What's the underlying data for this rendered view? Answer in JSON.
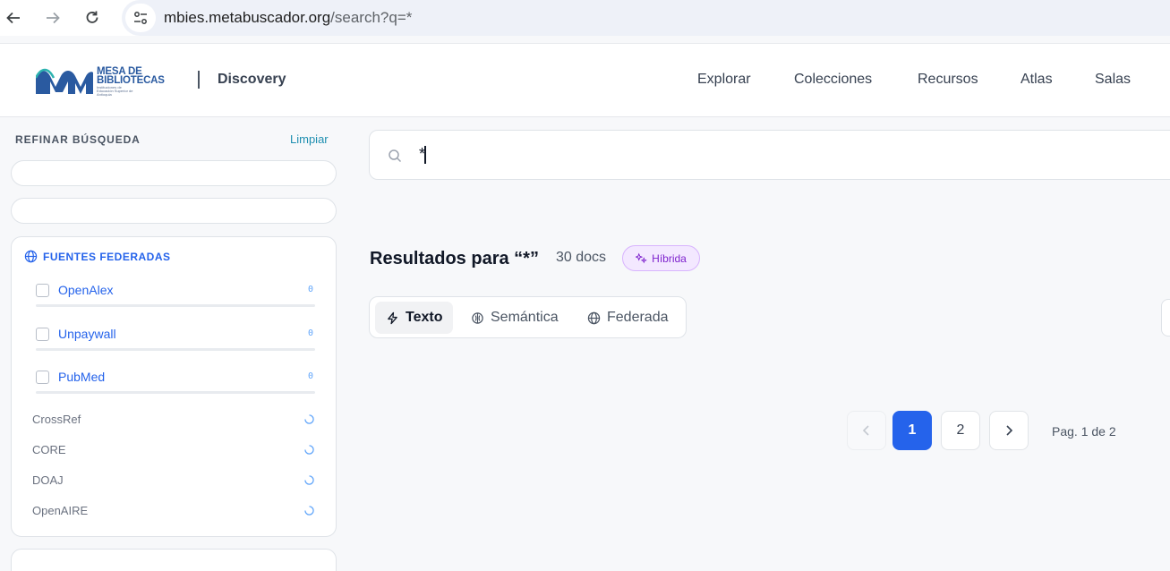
{
  "browser": {
    "url_host": "mbies.metabuscador.org",
    "url_path": "/search?q=*"
  },
  "header": {
    "logo_title": "MESA DE BIBLIOTECAS",
    "logo_subtitle": "Instituciones de Educación Superior de Antioquia",
    "brand": "Discovery",
    "nav": [
      "Explorar",
      "Colecciones",
      "Recursos",
      "Atlas",
      "Salas"
    ]
  },
  "sidebar": {
    "title": "REFINAR BÚSQUEDA",
    "clear_label": "Limpiar",
    "federated": {
      "title": "FUENTES FEDERADAS",
      "sources": [
        {
          "name": "OpenAlex",
          "count": "0"
        },
        {
          "name": "Unpaywall",
          "count": "0"
        },
        {
          "name": "PubMed",
          "count": "0"
        }
      ],
      "pending": [
        "CrossRef",
        "CORE",
        "DOAJ",
        "OpenAIRE"
      ]
    }
  },
  "search": {
    "value": "*"
  },
  "results": {
    "title": "Resultados para “*”",
    "count": "30 docs",
    "mode_badge": "Híbrida"
  },
  "tabs": [
    {
      "label": "Texto",
      "icon": "bolt-icon",
      "active": true
    },
    {
      "label": "Semántica",
      "icon": "brain-icon",
      "active": false
    },
    {
      "label": "Federada",
      "icon": "globe-icon",
      "active": false
    }
  ],
  "pagination": {
    "pages": [
      "1",
      "2"
    ],
    "current": "1",
    "info": "Pag. 1 de 2"
  },
  "colors": {
    "accent": "#2563eb",
    "badge": "#7e22ce",
    "clear_link": "#1f8fb0"
  }
}
